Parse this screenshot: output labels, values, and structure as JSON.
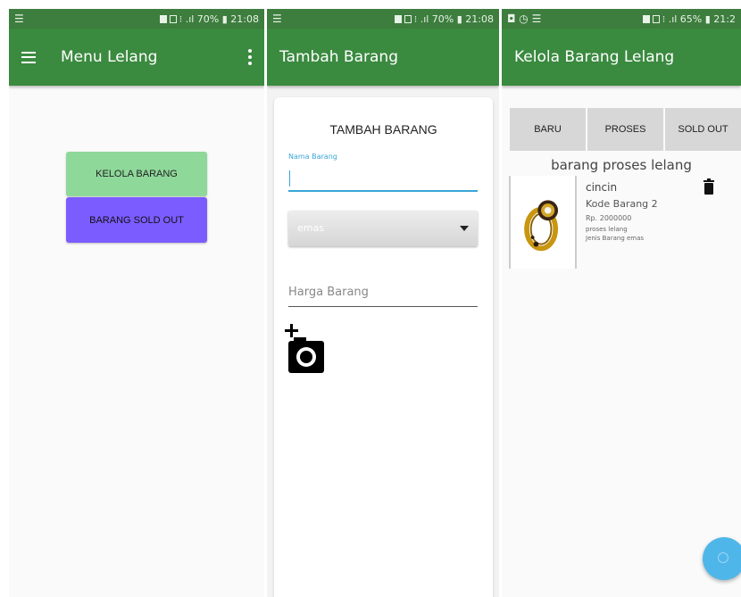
{
  "screens": [
    {
      "status": {
        "left_icon": "☰",
        "right_text": "⁝ .ıl 70% ▮ 21:08"
      },
      "appbar": {
        "title": "Menu Lelang"
      },
      "buttons": {
        "kelola": "KELOLA BARANG",
        "soldout": "BARANG SOLD OUT"
      }
    },
    {
      "status": {
        "left_icon": "☰",
        "right_text": "⁝ .ıl 70% ▮ 21:08"
      },
      "appbar": {
        "title": "Tambah Barang"
      },
      "form": {
        "heading": "TAMBAH BARANG",
        "nama_label": "Nama Barang",
        "jenis_selected": "emas",
        "harga_placeholder": "Harga Barang"
      }
    },
    {
      "status": {
        "left_icon": "◘ ◷ ☰",
        "right_text": "⁝ .ıl 65% ▮ 21:2"
      },
      "appbar": {
        "title": "Kelola Barang Lelang"
      },
      "tabs": [
        "BARU",
        "PROSES",
        "SOLD OUT"
      ],
      "section_title": "barang proses lelang",
      "item": {
        "name": "cincin",
        "kode": "Kode Barang 2",
        "harga": "Rp. 2000000",
        "status": "proses lelang",
        "jenis": "Jenis Barang emas"
      }
    }
  ],
  "colors": {
    "status_bar": "#3d7d3d",
    "app_bar": "#3a8a3f",
    "kelola_button": "#8ed89a",
    "soldout_button": "#7b5cff",
    "accent": "#3aa5d8",
    "fab": "#4fb6ea"
  },
  "icons": [
    "menu-icon",
    "more-vert-icon",
    "add-photo-icon",
    "trash-icon",
    "add-icon",
    "ring-photo"
  ]
}
